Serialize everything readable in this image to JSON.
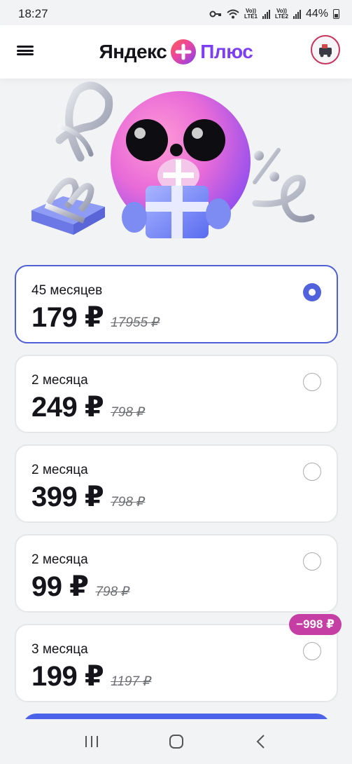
{
  "status_bar": {
    "time": "18:27",
    "sim1": "LTE1",
    "sim2": "LTE2",
    "volte": "Vo))",
    "battery_pct": "44%"
  },
  "header": {
    "logo_left": "Яндекс",
    "logo_right": "Плюс",
    "icons": [
      "menu-icon",
      "plus-logo-icon",
      "avatar"
    ]
  },
  "plans": [
    {
      "term": "45 месяцев",
      "price": "179 ₽",
      "old_price": "17955 ₽",
      "selected": true
    },
    {
      "term": "2 месяца",
      "price": "249 ₽",
      "old_price": "798 ₽",
      "selected": false
    },
    {
      "term": "2 месяца",
      "price": "399 ₽",
      "old_price": "798 ₽",
      "selected": false
    },
    {
      "term": "2 месяца",
      "price": "99 ₽",
      "old_price": "798 ₽",
      "selected": false
    },
    {
      "term": "3 месяца",
      "price": "199 ₽",
      "old_price": "1197 ₽",
      "selected": false,
      "badge": "−998 ₽"
    }
  ],
  "colors": {
    "accent": "#5062dc",
    "badge": "#c53ea4",
    "brand_purple": "#7e3ff2"
  }
}
